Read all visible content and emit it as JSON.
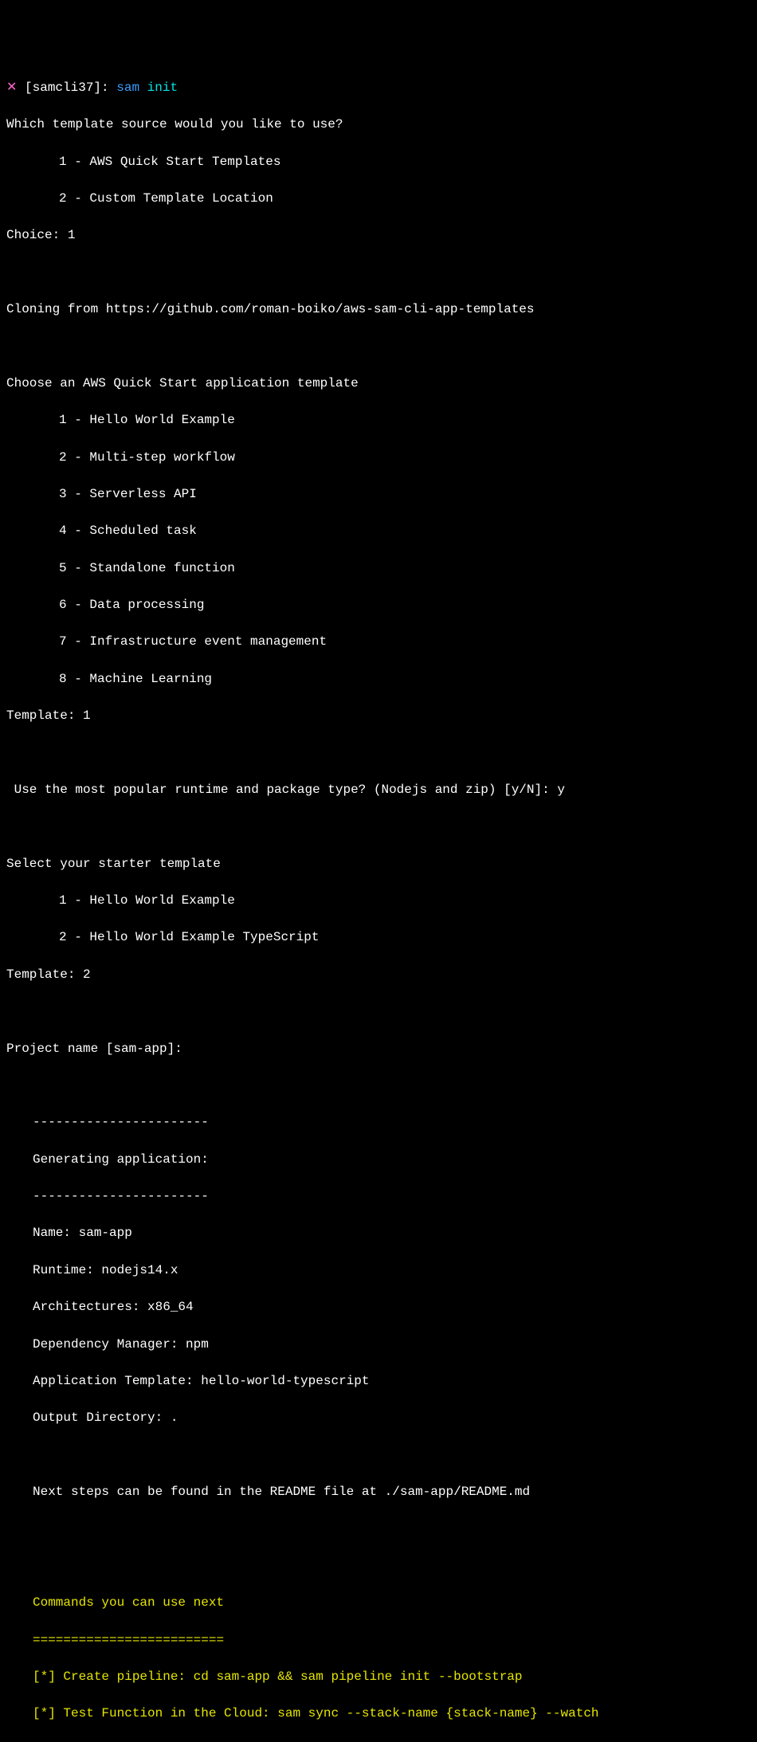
{
  "prompt": {
    "close_symbol": "✕",
    "bracket": "[samcli37]:",
    "cmd1": "sam",
    "cmd2": "init"
  },
  "q_template_source": "Which template source would you like to use?",
  "template_source_options": {
    "1": "1 - AWS Quick Start Templates",
    "2": "2 - Custom Template Location"
  },
  "choice_line": "Choice: 1",
  "cloning_line": "Cloning from https://github.com/roman-boiko/aws-sam-cli-app-templates",
  "q_quick_start": "Choose an AWS Quick Start application template",
  "quick_start_options": {
    "1": "1 - Hello World Example",
    "2": "2 - Multi-step workflow",
    "3": "3 - Serverless API",
    "4": "4 - Scheduled task",
    "5": "5 - Standalone function",
    "6": "6 - Data processing",
    "7": "7 - Infrastructure event management",
    "8": "8 - Machine Learning"
  },
  "template_choice_1": "Template: 1",
  "popular_runtime": " Use the most popular runtime and package type? (Nodejs and zip) [y/N]: y",
  "q_starter": "Select your starter template",
  "starter_options": {
    "1": "1 - Hello World Example",
    "2": "2 - Hello World Example TypeScript"
  },
  "template_choice_2": "Template: 2",
  "project_name": "Project name [sam-app]:",
  "gen": {
    "sep": "-----------------------",
    "title": "Generating application:",
    "name": "Name: sam-app",
    "runtime": "Runtime: nodejs14.x",
    "arch": "Architectures: x86_64",
    "dep": "Dependency Manager: npm",
    "apptpl": "Application Template: hello-world-typescript",
    "outdir": "Output Directory: .",
    "next_steps": "Next steps can be found in the README file at ./sam-app/README.md"
  },
  "next": {
    "header": "Commands you can use next",
    "sep": "=========================",
    "pipeline": "[*] Create pipeline: cd sam-app && sam pipeline init --bootstrap",
    "test": "[*] Test Function in the Cloud: sam sync --stack-name {stack-name} --watch"
  }
}
